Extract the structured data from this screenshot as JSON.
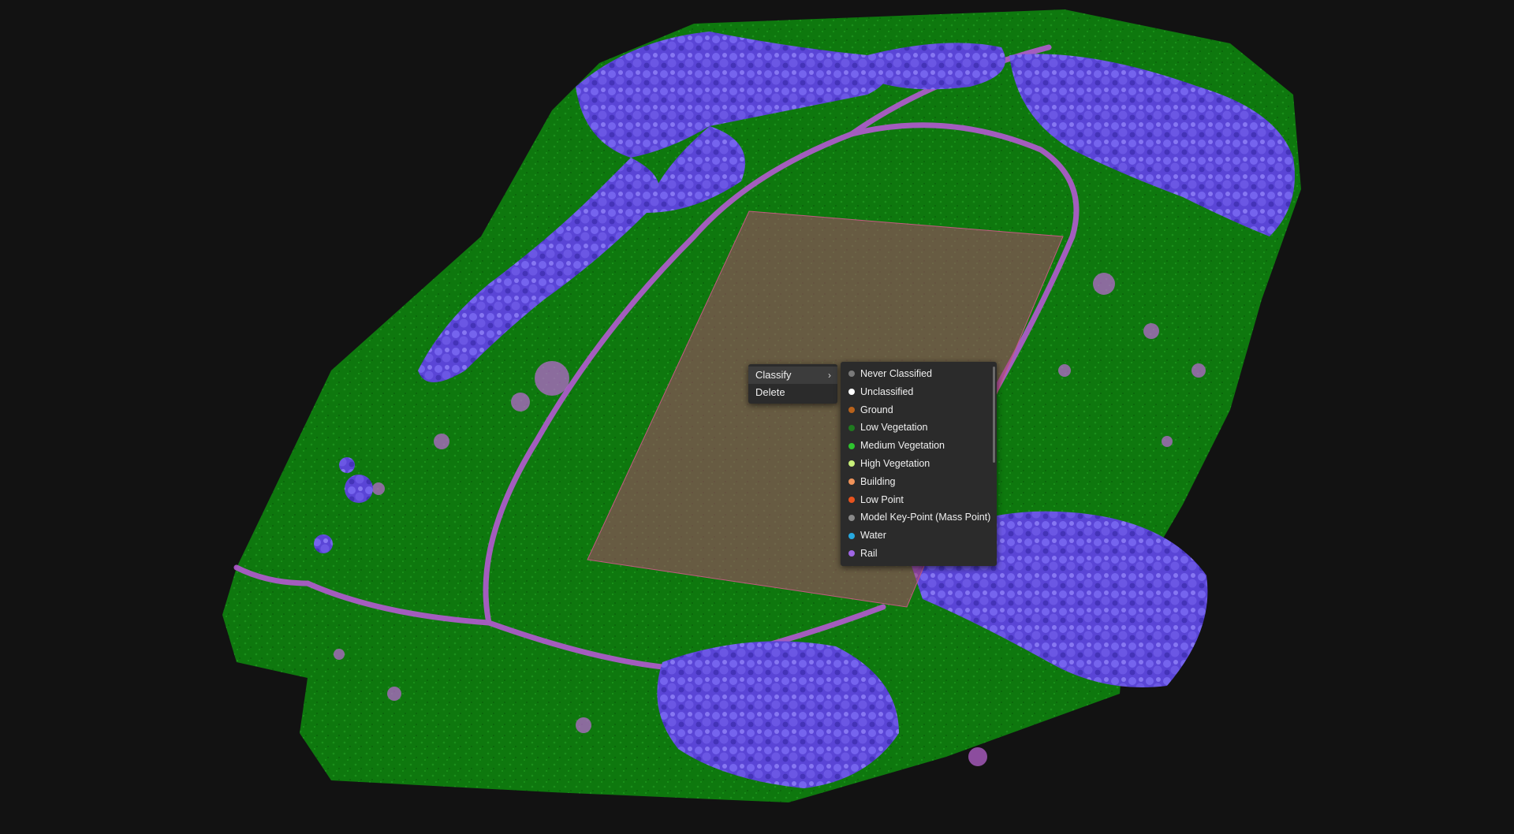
{
  "viewer": {
    "background": "#121212",
    "ground_green": "#0f7a0f",
    "tree_purple": "#6b55e0",
    "rail_pink": "#b45ad2",
    "selection_fill": "#b0446e"
  },
  "context_menu": {
    "items": [
      {
        "label": "Classify",
        "has_submenu": true,
        "active": true
      },
      {
        "label": "Delete",
        "has_submenu": false,
        "active": false
      }
    ],
    "chevron_icon": "chevron-right-icon"
  },
  "classify_submenu": {
    "items": [
      {
        "label": "Never Classified",
        "color": "#7a7a7a"
      },
      {
        "label": "Unclassified",
        "color": "#ffffff"
      },
      {
        "label": "Ground",
        "color": "#b8621b"
      },
      {
        "label": "Low Vegetation",
        "color": "#1f7a1f"
      },
      {
        "label": "Medium Vegetation",
        "color": "#2ec42e"
      },
      {
        "label": "High Vegetation",
        "color": "#c8f07a"
      },
      {
        "label": "Building",
        "color": "#f0935a"
      },
      {
        "label": "Low Point",
        "color": "#e8531e"
      },
      {
        "label": "Model Key-Point (Mass Point)",
        "color": "#8a8a8a"
      },
      {
        "label": "Water",
        "color": "#27a9e0"
      },
      {
        "label": "Rail",
        "color": "#a066e6"
      }
    ]
  }
}
